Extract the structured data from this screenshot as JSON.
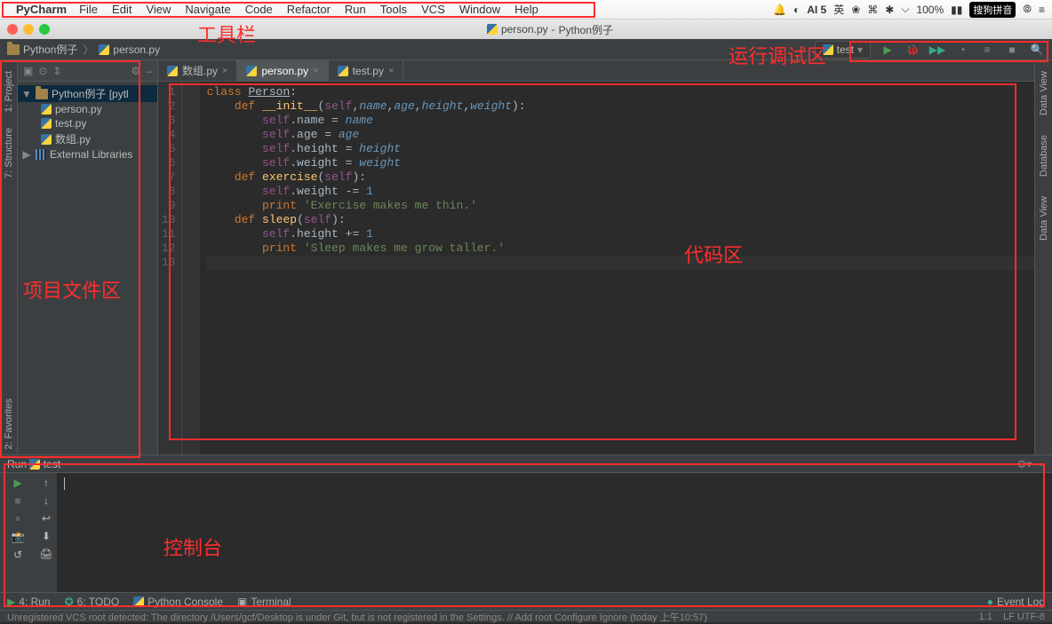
{
  "mac_menu": {
    "app": "PyCharm",
    "items": [
      "File",
      "Edit",
      "View",
      "Navigate",
      "Code",
      "Refactor",
      "Run",
      "Tools",
      "VCS",
      "Window",
      "Help"
    ],
    "tray": {
      "ai": "AI 5",
      "wifi_pct": "100%",
      "battery": "⚡",
      "ime": "搜狗拼音"
    }
  },
  "window_title": {
    "file": "person.py",
    "project": "Python例子"
  },
  "breadcrumbs": {
    "project": "Python例子",
    "file": "person.py"
  },
  "run_config": {
    "name": "test"
  },
  "project_tree": {
    "root": "Python例子 [pytl",
    "files": [
      "person.py",
      "test.py",
      "数组.py"
    ],
    "ext_lib": "External Libraries"
  },
  "editor_tabs": [
    {
      "name": "数组.py",
      "active": false
    },
    {
      "name": "person.py",
      "active": true
    },
    {
      "name": "test.py",
      "active": false
    }
  ],
  "code_lines": [
    "class Person:",
    "    def __init__(self,name,age,height,weight):",
    "        self.name = name",
    "        self.age = age",
    "        self.height = height",
    "        self.weight = weight",
    "    def exercise(self):",
    "        self.weight -= 1",
    "        print 'Exercise makes me thin.'",
    "    def sleep(self):",
    "        self.height += 1",
    "        print 'Sleep makes me grow taller.'",
    ""
  ],
  "run_panel": {
    "title_prefix": "Run",
    "title_cfg": "test"
  },
  "bottom_bar": {
    "run": "4: Run",
    "todo": "6: TODO",
    "pyconsole": "Python Console",
    "terminal": "Terminal",
    "eventlog": "Event Log"
  },
  "status": {
    "msg": "Unregistered VCS root detected: The directory /Users/gcf/Desktop is under Git, but is not registered in the Settings. // Add root  Configure  Ignore (today 上午10:57)",
    "pos": "1:1",
    "enc": "LF  UTF-8"
  },
  "sidebars": {
    "left": [
      "1: Project",
      "7: Structure"
    ],
    "right": [
      "Data View",
      "Database",
      "Data View"
    ],
    "favorites": "2: Favorites"
  },
  "annotations": {
    "toolbar": "工具栏",
    "rundebug": "运行调试区",
    "projectfiles": "项目文件区",
    "codearea": "代码区",
    "console": "控制台"
  }
}
